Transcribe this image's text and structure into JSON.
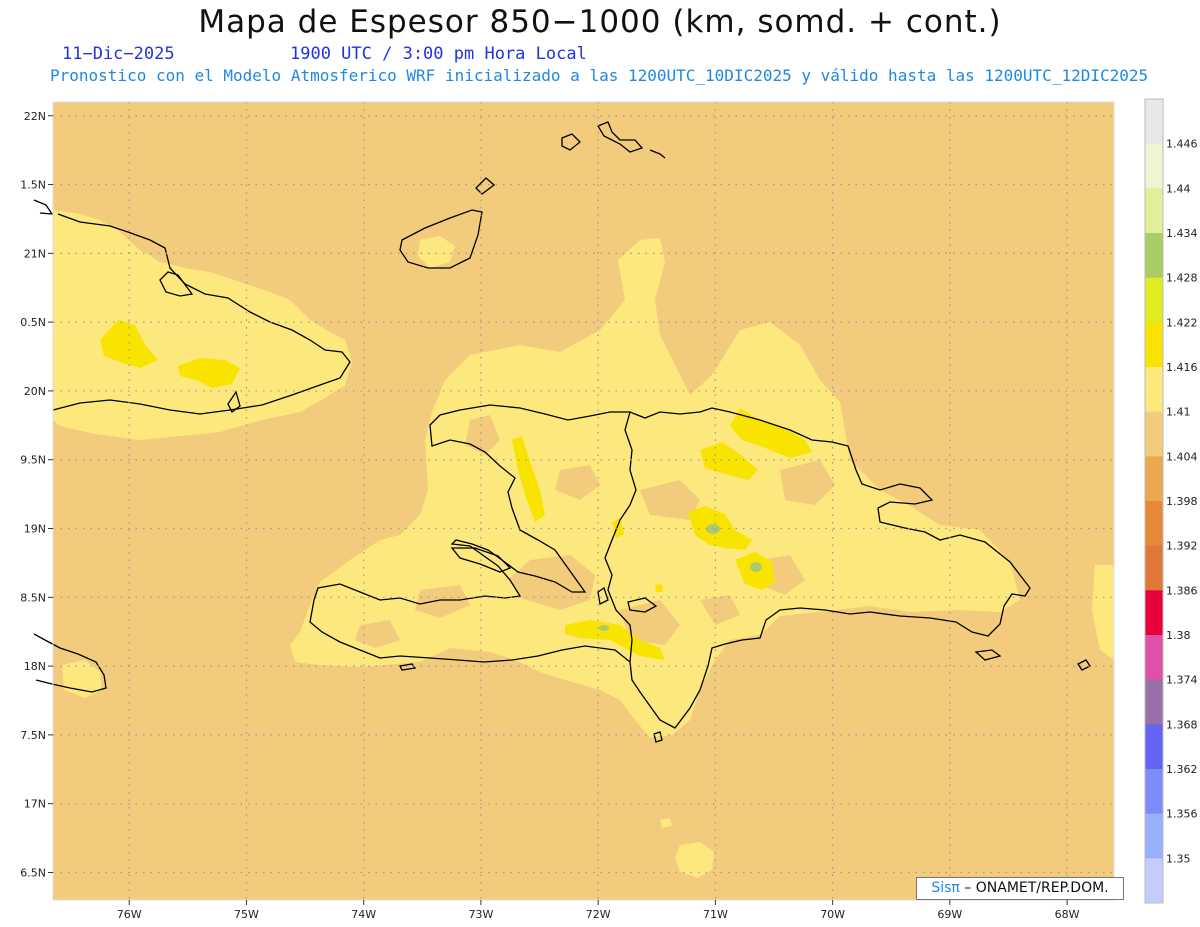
{
  "header": {
    "title": "Mapa de Espesor 850−1000 (km, somd. + cont.)",
    "date": "11−Dic−2025",
    "time": "1900 UTC / 3:00 pm Hora Local",
    "description": "Pronostico con el Modelo Atmosferico WRF inicializado a las 1200UTC_10DIC2025 y válido hasta las  1200UTC_12DIC2025"
  },
  "map": {
    "lat_labels": [
      "22N",
      "1.5N",
      "21N",
      "0.5N",
      "20N",
      "9.5N",
      "19N",
      "8.5N",
      "18N",
      "7.5N",
      "17N",
      "6.5N"
    ],
    "lon_labels": [
      "76W",
      "75W",
      "74W",
      "73W",
      "72W",
      "71W",
      "70W",
      "69W",
      "68W"
    ],
    "lat_range": [
      16.3,
      22.1
    ],
    "lon_range": [
      -76.65,
      -67.6
    ],
    "background_color": "#f2cc7c",
    "coast_color": "#000000",
    "grid_color": "#999999"
  },
  "colorbar": {
    "labels": [
      "1.446",
      "1.44",
      "1.434",
      "1.428",
      "1.422",
      "1.416",
      "1.41",
      "1.404",
      "1.398",
      "1.392",
      "1.386",
      "1.38",
      "1.374",
      "1.368",
      "1.362",
      "1.356",
      "1.35"
    ],
    "colors": [
      "#e8e8e8",
      "#f0f4d0",
      "#e0f09a",
      "#aacc66",
      "#e0ec20",
      "#f8e400",
      "#fde87e",
      "#f2cc7c",
      "#eca850",
      "#e68838",
      "#df7838",
      "#e8003c",
      "#e050a8",
      "#9870a8",
      "#6464f4",
      "#7c8cfc",
      "#98b0fc",
      "#c4ccfc"
    ]
  },
  "credit": {
    "brand": "Sisπ",
    "org": " – ONAMET/REP.DOM."
  }
}
